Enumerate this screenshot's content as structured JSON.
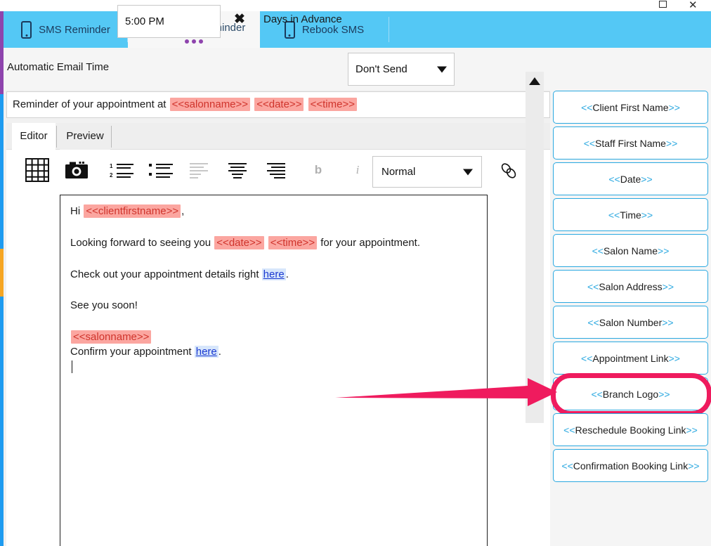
{
  "window": {
    "maximize_label": "▢",
    "close_label": "✕"
  },
  "tabs": [
    {
      "label": "SMS Reminder",
      "icon": "phone-icon",
      "active": false
    },
    {
      "label": "Email Reminder",
      "icon": "envelope-icon",
      "active": true
    },
    {
      "label": "Rebook SMS",
      "icon": "phone-icon",
      "active": false
    }
  ],
  "settings": {
    "auto_email_time_label": "Automatic Email Time",
    "auto_email_time_value": "5:00 PM",
    "clear_icon": "✖",
    "days_in_advance_label": "Days in Advance",
    "days_in_advance_value": "Don't Send"
  },
  "subject": {
    "prefix": "Reminder of your appointment at",
    "tokens": [
      "<<salonname>>",
      "<<date>>",
      "<<time>>"
    ]
  },
  "editor_tabs": [
    {
      "label": "Editor",
      "active": true
    },
    {
      "label": "Preview",
      "active": false
    }
  ],
  "toolbar": {
    "items": [
      {
        "name": "insert-table-icon",
        "label": "table"
      },
      {
        "name": "insert-image-icon",
        "label": "camera"
      },
      {
        "name": "ordered-list-icon",
        "label": "numbered list"
      },
      {
        "name": "unordered-list-icon",
        "label": "bullet list"
      },
      {
        "name": "align-left-icon",
        "label": "align left"
      },
      {
        "name": "align-center-icon",
        "label": "align center"
      },
      {
        "name": "align-right-icon",
        "label": "align right"
      },
      {
        "name": "bold-icon",
        "label": "b"
      },
      {
        "name": "italic-icon",
        "label": "i"
      },
      {
        "name": "insert-link-icon",
        "label": "link"
      }
    ],
    "bold_label": "b",
    "italic_label": "i",
    "style_select_value": "Normal"
  },
  "body": {
    "line1_pre": "Hi ",
    "line1_token": "<<clientfirstname>>",
    "line1_post": ",",
    "line2_pre": "Looking forward to seeing you ",
    "line2_token_date": "<<date>>",
    "line2_token_time": "<<time>>",
    "line2_post": " for your appointment.",
    "line3_pre": "Check out your appointment details right ",
    "line3_link": "here",
    "line3_post": ".",
    "line4": "See you soon!",
    "line5_token": "<<salonname>>",
    "line6_pre": "Confirm your appointment ",
    "line6_link": "here",
    "line6_post": "."
  },
  "scrollbar": {
    "up_arrow": "▲"
  },
  "token_panel": {
    "buttons": [
      {
        "open": "<<",
        "text": "Client First Name",
        "close": ">>",
        "highlighted": false
      },
      {
        "open": "<<",
        "text": "Staff First Name",
        "close": ">>",
        "highlighted": false
      },
      {
        "open": "<<",
        "text": "Date",
        "close": ">>",
        "highlighted": false
      },
      {
        "open": "<<",
        "text": "Time",
        "close": ">>",
        "highlighted": false
      },
      {
        "open": "<<",
        "text": "Salon Name",
        "close": ">>",
        "highlighted": false
      },
      {
        "open": "<<",
        "text": "Salon Address",
        "close": ">>",
        "highlighted": false
      },
      {
        "open": "<<",
        "text": "Salon Number",
        "close": ">>",
        "highlighted": false
      },
      {
        "open": "<<",
        "text": "Appointment Link",
        "close": ">>",
        "highlighted": false
      },
      {
        "open": "<<",
        "text": "Branch Logo",
        "close": ">>",
        "highlighted": true
      },
      {
        "open": "<<",
        "text": "Reschedule Booking Link",
        "close": ">>",
        "highlighted": false
      },
      {
        "open": "<<",
        "text": "Confirmation Booking Link",
        "close": ">>",
        "highlighted": false
      }
    ]
  },
  "annotation": {
    "arrow_color": "#ef1b5e",
    "highlight_color": "#ef1b5e",
    "target": "Branch Logo"
  },
  "colors": {
    "tab_bar": "#54c8f5",
    "token_bg": "#fba6a0",
    "token_text": "#d0342c",
    "button_border": "#2aa8e0",
    "link": "#1b3ad1",
    "accent_pink": "#ef1b5e"
  }
}
